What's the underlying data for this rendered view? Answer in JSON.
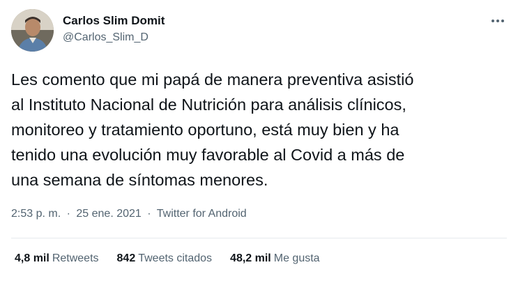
{
  "author": {
    "display_name": "Carlos Slim Domit",
    "handle": "@Carlos_Slim_D",
    "avatar_icon": "profile-photo"
  },
  "more_icon": "more-options-icon",
  "tweet": {
    "lines": [
      "Les comento que mi papá de manera preventiva asistió",
      "al Instituto Nacional de Nutrición para análisis clínicos,",
      "monitoreo y tratamiento oportuno, está muy bien y ha",
      "tenido una evolución muy favorable al Covid a más de",
      "una semana de síntomas menores."
    ]
  },
  "meta": {
    "time": "2:53 p. m.",
    "separator": "·",
    "date": "25 ene. 2021",
    "source": "Twitter for Android"
  },
  "stats": {
    "retweets": {
      "count": "4,8 mil",
      "label": "Retweets"
    },
    "quotes": {
      "count": "842",
      "label": "Tweets citados"
    },
    "likes": {
      "count": "48,2 mil",
      "label": "Me gusta"
    }
  },
  "colors": {
    "text": "#0f1419",
    "secondary": "#536471",
    "divider": "#e7eaed"
  }
}
